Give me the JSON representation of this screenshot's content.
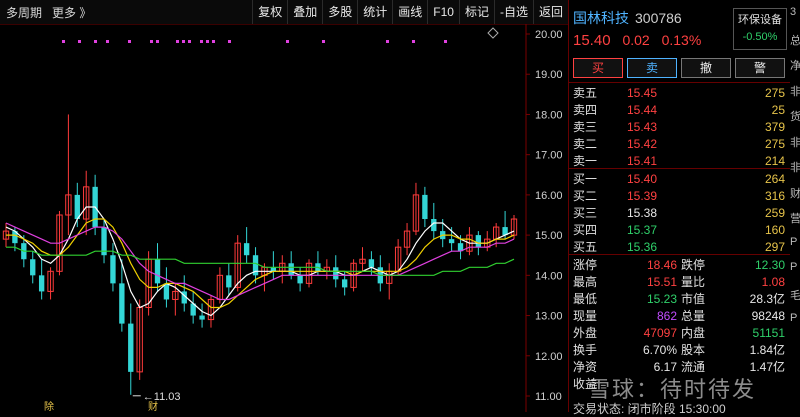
{
  "toolbar": {
    "left": [
      "多周期",
      "更多 》"
    ],
    "buttons": [
      "复权",
      "叠加",
      "多股",
      "统计",
      "画线",
      "F10",
      "标记",
      "-自选",
      "返回"
    ]
  },
  "chart_data": {
    "type": "candlestick",
    "y_ticks": [
      "20.00",
      "19.00",
      "18.00",
      "17.00",
      "16.00",
      "15.00",
      "14.00",
      "13.00",
      "12.00",
      "11.00"
    ],
    "ylim": [
      11,
      20
    ],
    "low_marker": "11.03",
    "bottom_marks": [
      "除",
      "财"
    ],
    "candles": [
      [
        14.9,
        15.3,
        14.7,
        15.1
      ],
      [
        15.1,
        15.2,
        14.6,
        14.8
      ],
      [
        14.8,
        15.0,
        14.2,
        14.4
      ],
      [
        14.4,
        14.6,
        13.8,
        14.0
      ],
      [
        14.0,
        14.4,
        13.4,
        13.6
      ],
      [
        13.6,
        14.2,
        13.4,
        14.1
      ],
      [
        14.1,
        15.6,
        14.0,
        15.5
      ],
      [
        15.5,
        18.0,
        15.0,
        16.0
      ],
      [
        16.0,
        16.3,
        15.2,
        15.4
      ],
      [
        15.4,
        16.6,
        15.0,
        16.2
      ],
      [
        16.2,
        16.5,
        15.0,
        15.2
      ],
      [
        15.2,
        15.4,
        14.3,
        14.5
      ],
      [
        14.5,
        14.8,
        13.6,
        13.8
      ],
      [
        13.8,
        14.4,
        12.6,
        12.8
      ],
      [
        12.8,
        13.3,
        11.03,
        11.6
      ],
      [
        11.6,
        13.4,
        11.4,
        13.2
      ],
      [
        13.2,
        14.6,
        13.0,
        14.4
      ],
      [
        14.4,
        14.8,
        13.6,
        13.8
      ],
      [
        13.8,
        14.2,
        13.2,
        13.4
      ],
      [
        13.4,
        13.8,
        13.0,
        13.6
      ],
      [
        13.6,
        14.0,
        13.1,
        13.3
      ],
      [
        13.3,
        13.6,
        12.8,
        13.0
      ],
      [
        13.0,
        13.3,
        12.7,
        12.9
      ],
      [
        12.9,
        13.5,
        12.7,
        13.4
      ],
      [
        13.4,
        14.2,
        13.3,
        14.0
      ],
      [
        14.0,
        14.3,
        13.5,
        13.7
      ],
      [
        13.7,
        15.0,
        13.6,
        14.8
      ],
      [
        14.8,
        15.2,
        14.3,
        14.5
      ],
      [
        14.5,
        14.7,
        13.8,
        14.0
      ],
      [
        14.0,
        14.3,
        13.6,
        14.2
      ],
      [
        14.2,
        14.6,
        13.9,
        14.1
      ],
      [
        14.1,
        14.5,
        13.8,
        14.3
      ],
      [
        14.3,
        14.6,
        13.9,
        14.0
      ],
      [
        14.0,
        14.2,
        13.6,
        13.8
      ],
      [
        13.8,
        14.4,
        13.7,
        14.3
      ],
      [
        14.3,
        14.6,
        14.0,
        14.1
      ],
      [
        14.1,
        14.4,
        13.9,
        14.2
      ],
      [
        14.2,
        14.5,
        13.7,
        13.9
      ],
      [
        13.9,
        14.1,
        13.5,
        13.7
      ],
      [
        13.7,
        14.4,
        13.6,
        14.3
      ],
      [
        14.3,
        14.7,
        14.1,
        14.4
      ],
      [
        14.4,
        14.6,
        14.0,
        14.2
      ],
      [
        14.2,
        14.5,
        13.6,
        13.8
      ],
      [
        13.8,
        14.3,
        13.4,
        14.1
      ],
      [
        14.1,
        14.9,
        14.0,
        14.7
      ],
      [
        14.7,
        15.3,
        14.5,
        15.1
      ],
      [
        15.1,
        16.3,
        15.0,
        16.0
      ],
      [
        16.0,
        16.2,
        15.2,
        15.4
      ],
      [
        15.4,
        15.8,
        14.9,
        15.1
      ],
      [
        15.1,
        15.4,
        14.7,
        14.9
      ],
      [
        14.9,
        15.2,
        14.6,
        14.8
      ],
      [
        14.8,
        15.0,
        14.4,
        14.6
      ],
      [
        14.6,
        15.2,
        14.5,
        15.0
      ],
      [
        15.0,
        15.1,
        14.5,
        14.7
      ],
      [
        14.7,
        15.1,
        14.6,
        14.9
      ],
      [
        14.9,
        15.3,
        14.7,
        15.2
      ],
      [
        15.2,
        15.6,
        14.9,
        15.0
      ],
      [
        15.0,
        15.5,
        14.9,
        15.4
      ]
    ],
    "ma_lines": [
      {
        "color": "#ffffff",
        "values": [
          15.2,
          15.1,
          14.9,
          14.7,
          14.4,
          14.3,
          14.5,
          14.9,
          15.4,
          15.7,
          15.7,
          15.4,
          14.9,
          14.3,
          13.6,
          13.2,
          13.3,
          13.6,
          13.8,
          13.7,
          13.5,
          13.3,
          13.1,
          13.0,
          13.2,
          13.5,
          13.8,
          14.0,
          14.1,
          14.1,
          14.1,
          14.1,
          14.1,
          14.0,
          14.0,
          14.1,
          14.1,
          14.1,
          14.0,
          14.0,
          14.1,
          14.2,
          14.1,
          14.0,
          14.1,
          14.4,
          14.8,
          15.1,
          15.3,
          15.3,
          15.1,
          14.9,
          14.8,
          14.8,
          14.8,
          14.9,
          15.0,
          15.1
        ]
      },
      {
        "color": "#f0d000",
        "values": [
          15.0,
          15.0,
          14.9,
          14.8,
          14.6,
          14.5,
          14.5,
          14.7,
          15.0,
          15.3,
          15.4,
          15.4,
          15.2,
          14.8,
          14.3,
          13.9,
          13.7,
          13.7,
          13.8,
          13.8,
          13.7,
          13.6,
          13.4,
          13.2,
          13.2,
          13.3,
          13.5,
          13.7,
          13.9,
          14.0,
          14.1,
          14.1,
          14.1,
          14.1,
          14.1,
          14.1,
          14.1,
          14.1,
          14.1,
          14.0,
          14.1,
          14.1,
          14.1,
          14.1,
          14.1,
          14.2,
          14.4,
          14.7,
          14.9,
          15.0,
          15.0,
          14.9,
          14.9,
          14.8,
          14.8,
          14.9,
          14.9,
          15.0
        ]
      },
      {
        "color": "#e040e0",
        "values": [
          15.3,
          15.2,
          15.1,
          15.0,
          14.9,
          14.8,
          14.8,
          14.9,
          15.0,
          15.1,
          15.2,
          15.2,
          15.1,
          14.9,
          14.6,
          14.3,
          14.1,
          14.0,
          13.9,
          13.8,
          13.8,
          13.7,
          13.6,
          13.5,
          13.4,
          13.4,
          13.5,
          13.6,
          13.7,
          13.8,
          13.9,
          14.0,
          14.0,
          14.0,
          14.0,
          14.0,
          14.0,
          14.0,
          14.0,
          14.0,
          14.0,
          14.0,
          14.0,
          14.0,
          14.0,
          14.1,
          14.2,
          14.3,
          14.4,
          14.5,
          14.6,
          14.6,
          14.7,
          14.7,
          14.7,
          14.8,
          14.8,
          14.9
        ]
      },
      {
        "color": "#30d030",
        "values": [
          14.7,
          14.7,
          14.6,
          14.6,
          14.5,
          14.5,
          14.5,
          14.5,
          14.5,
          14.5,
          14.6,
          14.6,
          14.6,
          14.5,
          14.5,
          14.4,
          14.4,
          14.4,
          14.4,
          14.4,
          14.3,
          14.3,
          14.3,
          14.3,
          14.3,
          14.3,
          14.3,
          14.3,
          14.3,
          14.2,
          14.2,
          14.2,
          14.2,
          14.2,
          14.2,
          14.2,
          14.1,
          14.1,
          14.1,
          14.1,
          14.1,
          14.1,
          14.0,
          14.0,
          14.0,
          14.0,
          14.0,
          14.0,
          14.0,
          14.1,
          14.1,
          14.1,
          14.2,
          14.2,
          14.2,
          14.3,
          14.3,
          14.4
        ]
      }
    ]
  },
  "stock": {
    "name": "国林科技",
    "code": "300786",
    "sector_name": "环保设备",
    "sector_change": "-0.50%",
    "price": "15.40",
    "change": "0.02",
    "change_pct": "0.13%"
  },
  "trade_buttons": [
    "买",
    "卖",
    "撤",
    "警"
  ],
  "asks": [
    {
      "label": "卖五",
      "price": "15.45",
      "vol": "275",
      "color": "red"
    },
    {
      "label": "卖四",
      "price": "15.44",
      "vol": "25",
      "color": "red"
    },
    {
      "label": "卖三",
      "price": "15.43",
      "vol": "379",
      "color": "red"
    },
    {
      "label": "卖二",
      "price": "15.42",
      "vol": "275",
      "color": "red"
    },
    {
      "label": "卖一",
      "price": "15.41",
      "vol": "214",
      "color": "red"
    }
  ],
  "bids": [
    {
      "label": "买一",
      "price": "15.40",
      "vol": "264",
      "color": "red"
    },
    {
      "label": "买二",
      "price": "15.39",
      "vol": "316",
      "color": "red"
    },
    {
      "label": "买三",
      "price": "15.38",
      "vol": "259",
      "color": "white"
    },
    {
      "label": "买四",
      "price": "15.37",
      "vol": "160",
      "color": "green"
    },
    {
      "label": "买五",
      "price": "15.36",
      "vol": "297",
      "color": "green"
    }
  ],
  "stats": [
    [
      {
        "label": "涨停",
        "value": "18.46",
        "color": "red"
      },
      {
        "label": "跌停",
        "value": "12.30",
        "color": "green"
      }
    ],
    [
      {
        "label": "最高",
        "value": "15.51",
        "color": "red"
      },
      {
        "label": "量比",
        "value": "1.08",
        "color": "red"
      }
    ],
    [
      {
        "label": "最低",
        "value": "15.23",
        "color": "green"
      },
      {
        "label": "市值",
        "value": "28.3亿",
        "color": "white"
      }
    ],
    [
      {
        "label": "现量",
        "value": "862",
        "color": "purple"
      },
      {
        "label": "总量",
        "value": "98248",
        "color": "white"
      }
    ],
    [
      {
        "label": "外盘",
        "value": "47097",
        "color": "red"
      },
      {
        "label": "内盘",
        "value": "51151",
        "color": "green"
      }
    ],
    [
      {
        "label": "换手",
        "value": "6.70%",
        "color": "white"
      },
      {
        "label": "股本",
        "value": "1.84亿",
        "color": "white"
      }
    ],
    [
      {
        "label": "净资",
        "value": "6.17",
        "color": "white"
      },
      {
        "label": "流通",
        "value": "1.47亿",
        "color": "white"
      }
    ],
    [
      {
        "label": "收益",
        "value": "",
        "color": "white"
      },
      {
        "label": "",
        "value": "",
        "color": "white"
      }
    ]
  ],
  "panel_bottom": "交易状态: 闭市阶段 15:30:00",
  "strip_chars": [
    "3",
    "总",
    "净",
    "非",
    "货",
    "非",
    "非",
    "财",
    "营",
    "P",
    "P",
    "毛",
    "P"
  ],
  "watermark": "雪球：待时待发"
}
